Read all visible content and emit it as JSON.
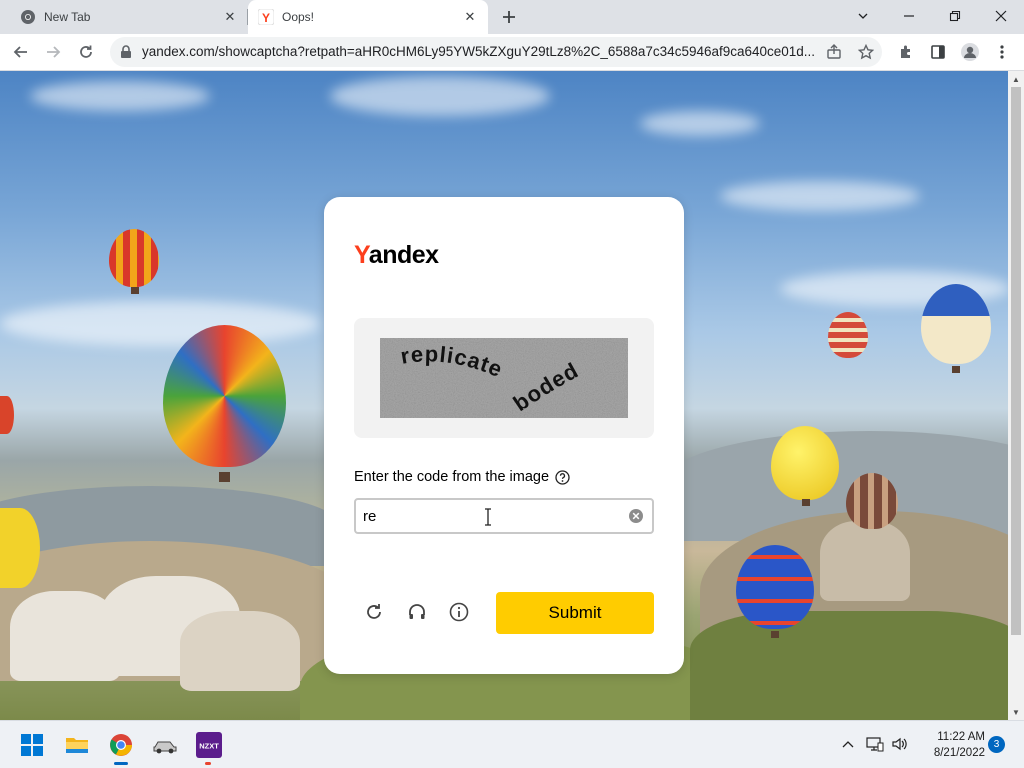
{
  "browser": {
    "tabs": [
      {
        "title": "New Tab",
        "favicon": "chrome-icon",
        "active": false
      },
      {
        "title": "Oops!",
        "favicon": "yandex-favicon",
        "active": true
      }
    ],
    "address": {
      "url": "yandex.com/showcaptcha?retpath=aHR0cHM6Ly95YW5kZXguY29tLz8%2C_6588a7c34c5946af9ca640ce01d..."
    },
    "toolbar_icons": [
      "back-icon",
      "forward-icon",
      "reload-icon",
      "lock-icon",
      "share-icon",
      "star-icon",
      "extensions-icon",
      "sidepanel-icon",
      "profile-icon",
      "menu-icon"
    ],
    "window_controls": [
      "chevron-down-icon",
      "minimize-icon",
      "restore-icon",
      "close-icon"
    ]
  },
  "captcha": {
    "logo_first": "Y",
    "logo_rest": "andex",
    "image_word_1": "replicate",
    "image_word_2": "boded",
    "prompt": "Enter the code from the image",
    "input_value": "re",
    "submit_label": "Submit",
    "action_icons": [
      "refresh-icon",
      "audio-icon",
      "info-icon"
    ]
  },
  "taskbar": {
    "apps": [
      "windows-start-icon",
      "file-explorer-icon",
      "chrome-icon",
      "car-app-icon",
      "nzxt-icon"
    ],
    "nzxt_label": "NZXT",
    "time": "11:22 AM",
    "date": "8/21/2022",
    "notification_count": "3"
  },
  "colors": {
    "accent_yellow": "#ffcc00",
    "yandex_red": "#fc3f1d",
    "taskbar_badge": "#0067c0"
  }
}
